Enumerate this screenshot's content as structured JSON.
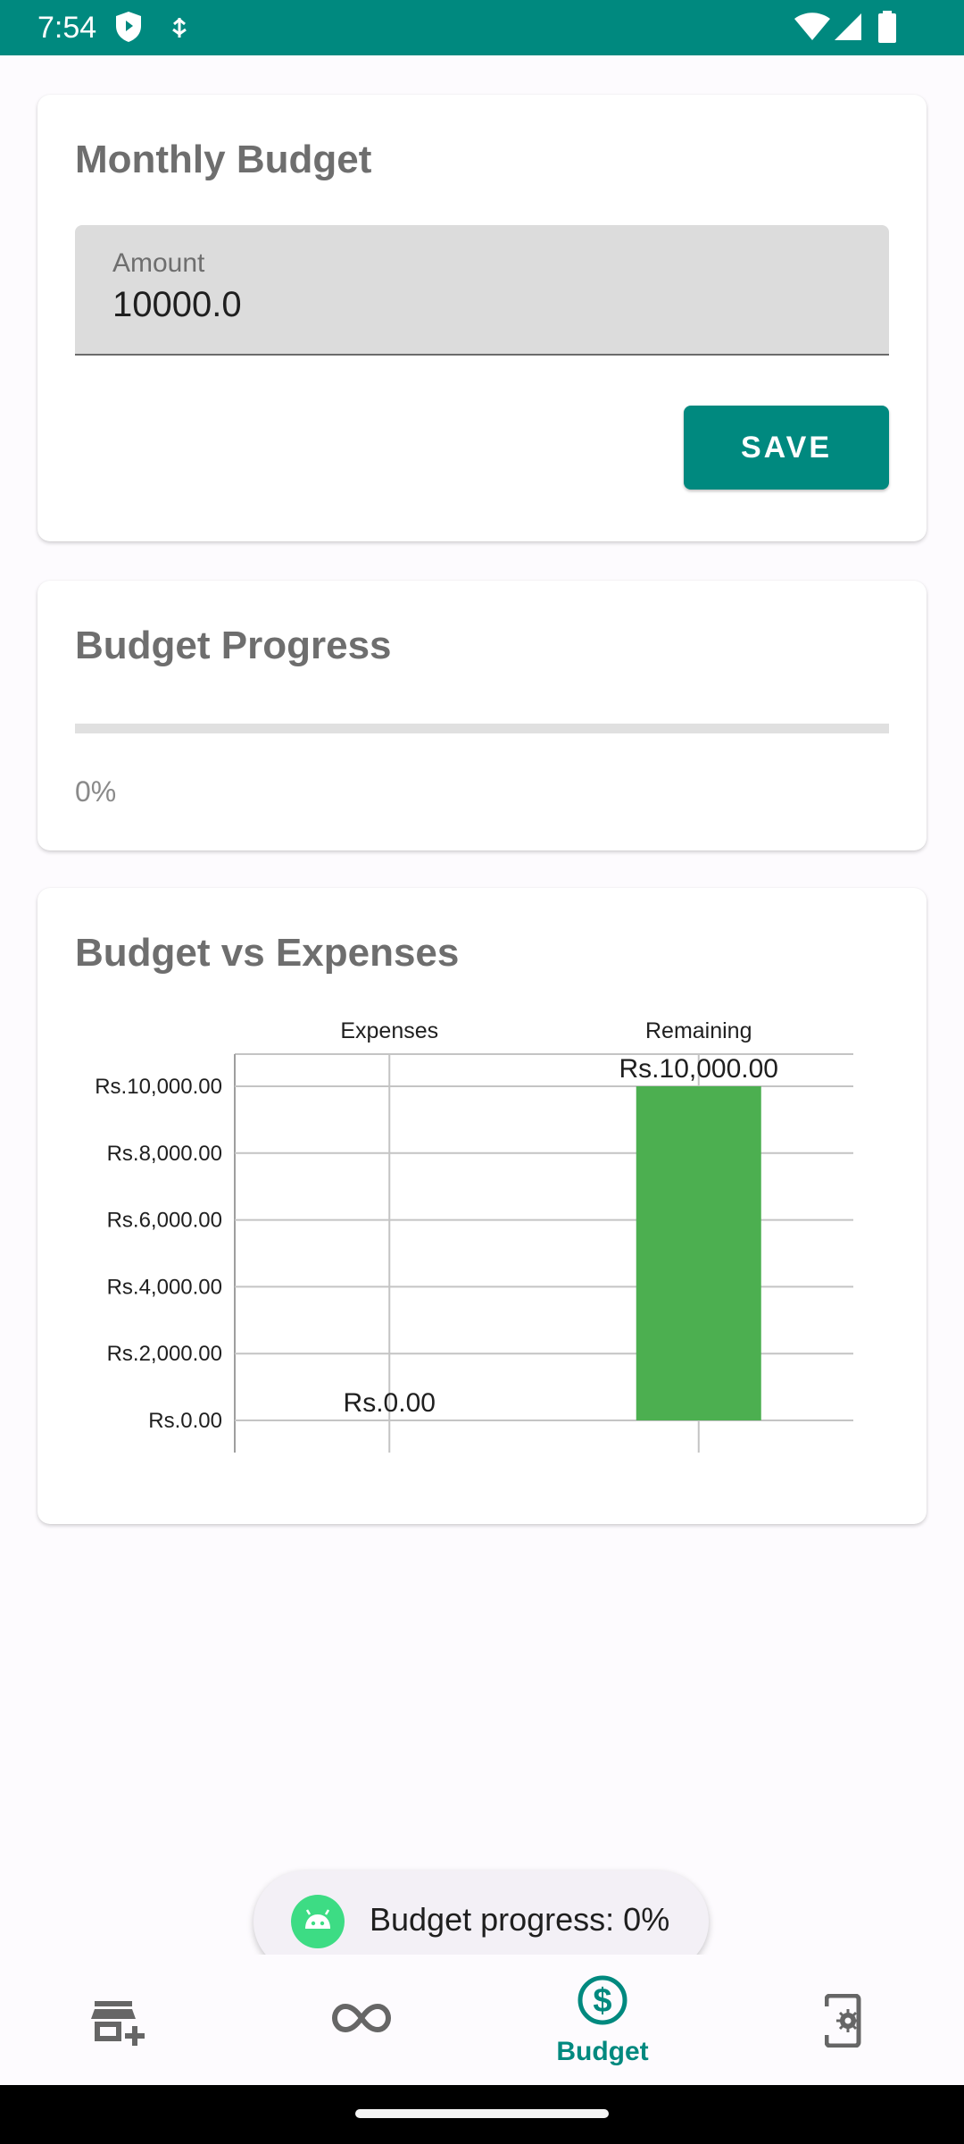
{
  "status_bar": {
    "time": "7:54",
    "icons": [
      "shield-icon",
      "usb-debug-icon",
      "wifi-icon",
      "signal-icon",
      "battery-icon"
    ]
  },
  "monthly_budget": {
    "title": "Monthly Budget",
    "amount_label": "Amount",
    "amount_value": "10000.0",
    "save_label": "SAVE"
  },
  "budget_progress": {
    "title": "Budget Progress",
    "progress_fraction": 0,
    "percent_text": "0%"
  },
  "budget_vs_expenses": {
    "title": "Budget vs Expenses"
  },
  "chart_data": {
    "type": "bar",
    "title": "",
    "categories": [
      "Expenses",
      "Remaining"
    ],
    "values": [
      0,
      10000
    ],
    "data_labels": [
      "Rs.0.00",
      "Rs.10,000.00"
    ],
    "bar_colors": [
      "#4caf50",
      "#4caf50"
    ],
    "ylim": [
      0,
      10000
    ],
    "yticks": [
      0,
      2000,
      4000,
      6000,
      8000,
      10000
    ],
    "ytick_labels": [
      "Rs.0.00",
      "Rs.2,000.00",
      "Rs.4,000.00",
      "Rs.6,000.00",
      "Rs.8,000.00",
      "Rs.10,000.00"
    ],
    "x_labels_position": "top",
    "grid": true,
    "legend": "none"
  },
  "toast": {
    "text": "Budget progress: 0%",
    "icon": "android-icon"
  },
  "bottom_nav": {
    "items": [
      {
        "icon": "add-store-icon",
        "label": ""
      },
      {
        "icon": "infinity-icon",
        "label": ""
      },
      {
        "icon": "dollar-circle-icon",
        "label": "Budget"
      },
      {
        "icon": "phone-settings-icon",
        "label": ""
      }
    ]
  },
  "colors": {
    "primary": "#00897f",
    "bar": "#4caf50",
    "title_text": "#6e6e6e"
  }
}
